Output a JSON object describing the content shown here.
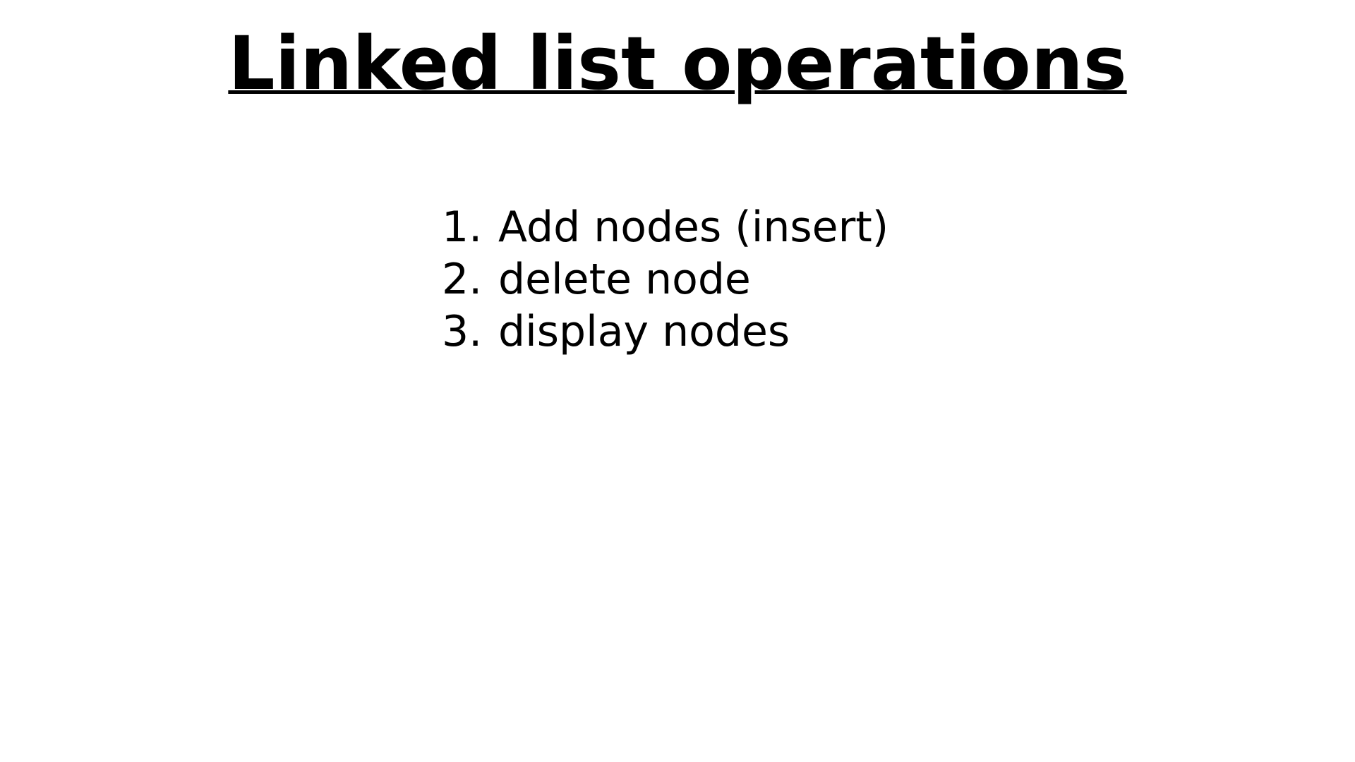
{
  "slide": {
    "title": "Linked list operations",
    "items": [
      {
        "number": "1.",
        "text": "Add nodes (insert)"
      },
      {
        "number": "2.",
        "text": "delete node"
      },
      {
        "number": "3.",
        "text": "display nodes"
      }
    ]
  },
  "colors": {
    "background": "#ffffff",
    "text": "#000000"
  }
}
